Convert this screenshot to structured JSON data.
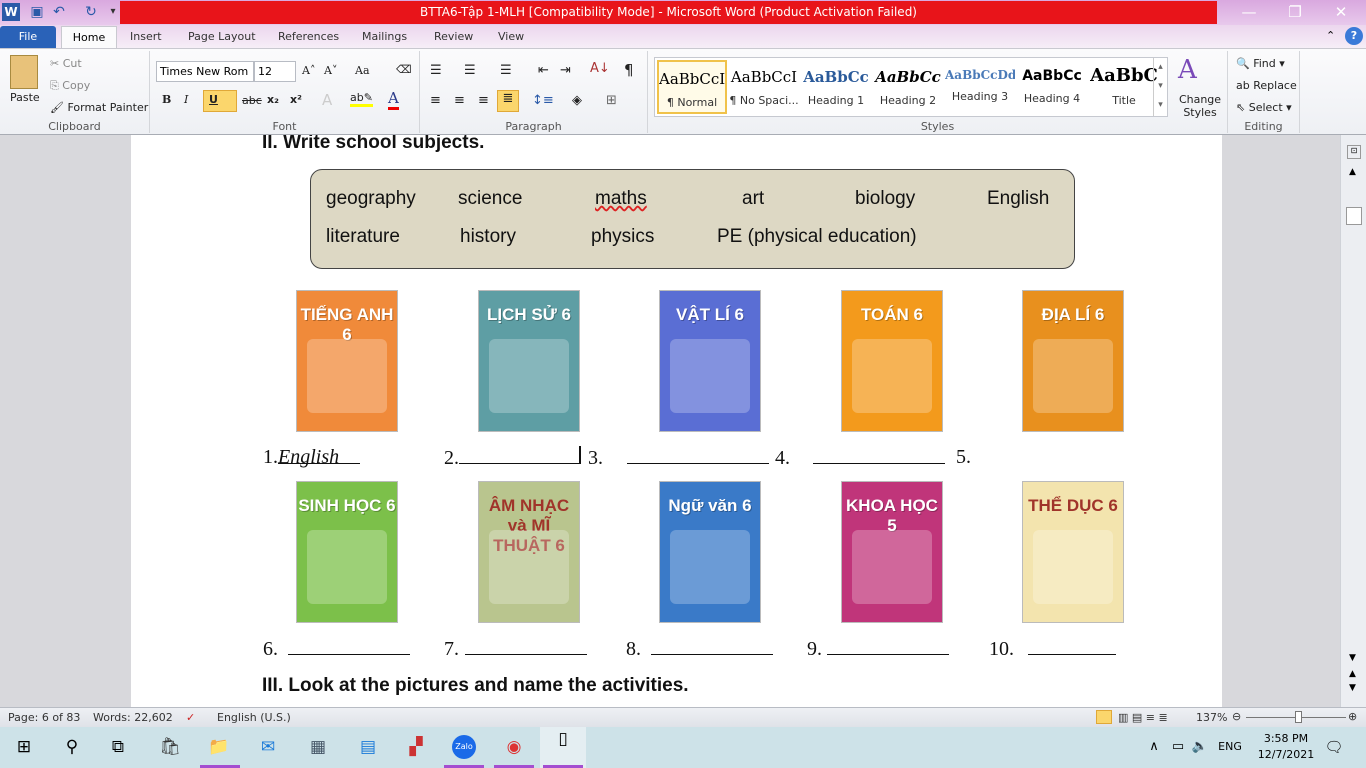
{
  "window": {
    "title": "BTTA6-Tập 1-MLH [Compatibility Mode]  -  Microsoft Word (Product Activation Failed)",
    "minimize": "—",
    "restore": "❐",
    "close": "✕"
  },
  "tabs": [
    "File",
    "Home",
    "Insert",
    "Page Layout",
    "References",
    "Mailings",
    "Review",
    "View"
  ],
  "clipboard": {
    "paste": "Paste",
    "cut": "Cut",
    "copy": "Copy",
    "format_painter": "Format Painter",
    "label": "Clipboard"
  },
  "font": {
    "name": "Times New Rom",
    "size": "12",
    "label": "Font",
    "bold": "B",
    "italic": "I",
    "underline": "U",
    "strike": "abc",
    "sub": "x₂",
    "sup": "x²",
    "grow": "A˄",
    "shrink": "A˅",
    "case": "Aa"
  },
  "paragraph": {
    "label": "Paragraph",
    "pilcrow": "¶"
  },
  "styles": {
    "label": "Styles",
    "items": [
      {
        "sample": "AaBbCcI",
        "name": "¶ Normal"
      },
      {
        "sample": "AaBbCcI",
        "name": "¶ No Spaci..."
      },
      {
        "sample": "AaBbCc",
        "name": "Heading 1"
      },
      {
        "sample": "AaBbCc",
        "name": "Heading 2"
      },
      {
        "sample": "AaBbCcDd",
        "name": "Heading 3"
      },
      {
        "sample": "AaBbCc",
        "name": "Heading 4"
      },
      {
        "sample": "AaBbC",
        "name": "Title"
      }
    ],
    "change": "Change Styles"
  },
  "editing": {
    "label": "Editing",
    "find": "Find",
    "replace": "Replace",
    "select": "Select"
  },
  "document": {
    "heading": "II. Write school subjects.",
    "words_row1": [
      "geography",
      "science",
      "maths",
      "art",
      "biology",
      "English"
    ],
    "words_row2": [
      "literature",
      "history",
      "physics",
      "PE (physical education)"
    ],
    "books_row1": [
      {
        "title": "TIẾNG ANH 6",
        "color": "#f08a3a"
      },
      {
        "title": "LỊCH SỬ 6",
        "color": "#5e9ea4"
      },
      {
        "title": "VẬT LÍ 6",
        "color": "#5a6ed4"
      },
      {
        "title": "TOÁN 6",
        "color": "#f39a1c"
      },
      {
        "title": "ĐỊA LÍ 6",
        "color": "#e8901e"
      }
    ],
    "books_row2": [
      {
        "title": "SINH HỌC 6",
        "color": "#7cc04a"
      },
      {
        "title": "ÂM NHẠC và MĨ THUẬT 6",
        "color": "#b9c58e"
      },
      {
        "title": "Ngữ văn 6",
        "color": "#3a7ac8"
      },
      {
        "title": "KHOA HỌC 5",
        "color": "#c0357a"
      },
      {
        "title": "THỂ DỤC 6",
        "color": "#f3e4ae"
      }
    ],
    "answers_row1": [
      {
        "num": "1.",
        "value": "English"
      },
      {
        "num": "2.",
        "value": ""
      },
      {
        "num": "3.",
        "value": ""
      },
      {
        "num": "4.",
        "value": ""
      },
      {
        "num": "5.",
        "value": ""
      }
    ],
    "answers_row2": [
      {
        "num": "6.",
        "value": ""
      },
      {
        "num": "7.",
        "value": ""
      },
      {
        "num": "8.",
        "value": ""
      },
      {
        "num": "9.",
        "value": ""
      },
      {
        "num": "10.",
        "value": ""
      }
    ],
    "next_heading": "III.  Look at the pictures and name the activities."
  },
  "status": {
    "page": "Page: 6 of 83",
    "words": "Words: 22,602",
    "language": "English (U.S.)",
    "zoom": "137%"
  },
  "taskbar": {
    "time": "3:58 PM",
    "date": "12/7/2021",
    "lang": "ENG"
  }
}
